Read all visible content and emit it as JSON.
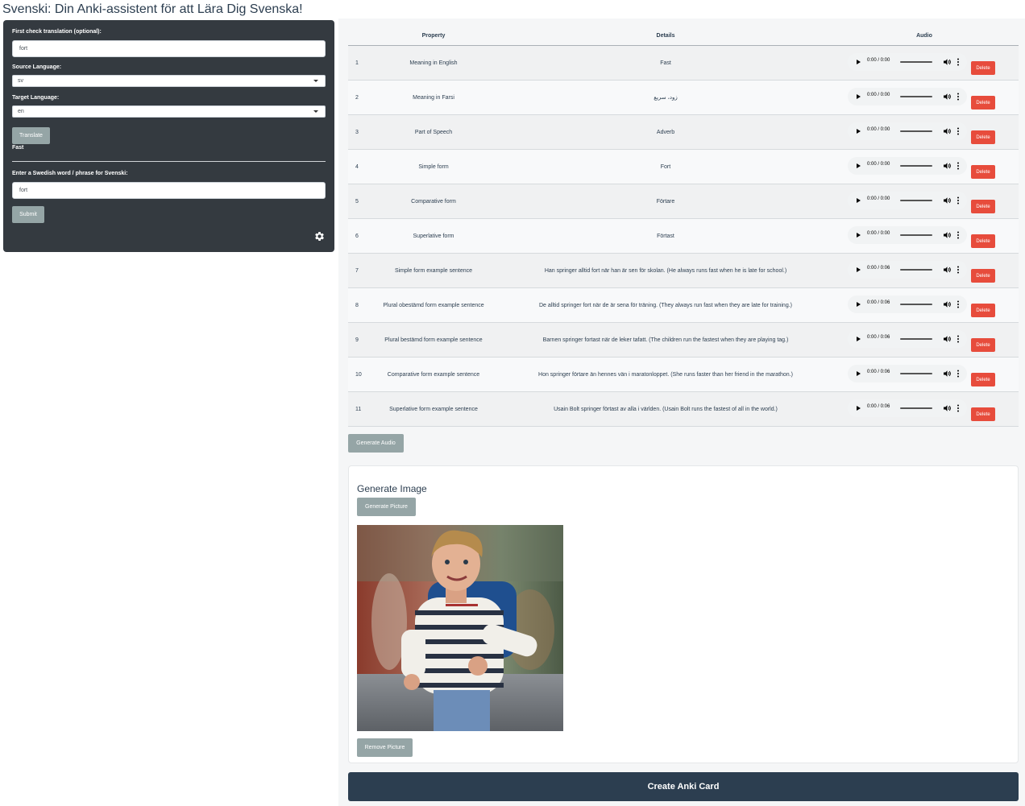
{
  "app_title": "Svenski: Din Anki-assistent för att Lära Dig Svenska!",
  "sidebar": {
    "check_label": "First check translation (optional):",
    "check_value": "fort",
    "source_label": "Source Language:",
    "source_value": "sv",
    "target_label": "Target Language:",
    "target_value": "en",
    "translate_label": "Translate",
    "translation_result": "Fast",
    "word_label": "Enter a Swedish word / phrase for Svenski:",
    "word_value": "fort",
    "submit_label": "Submit",
    "settings_icon": "gear-icon"
  },
  "table": {
    "headers": [
      "Property",
      "Details",
      "Audio"
    ],
    "rows": [
      {
        "num": "1",
        "property": "Meaning in English",
        "details": "Fast",
        "time": "0:00 / 0:00",
        "delete": "Delete"
      },
      {
        "num": "2",
        "property": "Meaning in Farsi",
        "details": "زود، سریع",
        "time": "0:00 / 0:00",
        "delete": "Delete"
      },
      {
        "num": "3",
        "property": "Part of Speech",
        "details": "Adverb",
        "time": "0:00 / 0:00",
        "delete": "Delete"
      },
      {
        "num": "4",
        "property": "Simple form",
        "details": "Fort",
        "time": "0:00 / 0:00",
        "delete": "Delete"
      },
      {
        "num": "5",
        "property": "Comparative form",
        "details": "Förtare",
        "time": "0:00 / 0:00",
        "delete": "Delete"
      },
      {
        "num": "6",
        "property": "Superlative form",
        "details": "Förtast",
        "time": "0:00 / 0:00",
        "delete": "Delete"
      },
      {
        "num": "7",
        "property": "Simple form example sentence",
        "details": "Han springer alltid fort när han är sen för skolan. (He always runs fast when he is late for school.)",
        "time": "0:00 / 0:06",
        "delete": "Delete"
      },
      {
        "num": "8",
        "property": "Plural obestämd form example sentence",
        "details": "De alltid springer fort när de är sena för träning. (They always run fast when they are late for training.)",
        "time": "0:00 / 0:06",
        "delete": "Delete"
      },
      {
        "num": "9",
        "property": "Plural bestämd form example sentence",
        "details": "Barnen springer fortast när de leker tafatt. (The children run the fastest when they are playing tag.)",
        "time": "0:00 / 0:06",
        "delete": "Delete"
      },
      {
        "num": "10",
        "property": "Comparative form example sentence",
        "details": "Hon springer förtare än hennes vän i maratonloppet. (She runs faster than her friend in the marathon.)",
        "time": "0:00 / 0:06",
        "delete": "Delete"
      },
      {
        "num": "11",
        "property": "Superlative form example sentence",
        "details": "Usain Bolt springer förtast av alla i världen. (Usain Bolt runs the fastest of all in the world.)",
        "time": "0:00 / 0:06",
        "delete": "Delete"
      }
    ]
  },
  "generate_audio_label": "Generate Audio",
  "image_card": {
    "title": "Generate Image",
    "generate_label": "Generate Picture",
    "remove_label": "Remove Picture"
  },
  "create_label": "Create Anki Card",
  "colors": {
    "sidebar_bg": "#343a40",
    "primary": "#2c3e50",
    "secondary_button": "#95a5a6",
    "delete_button": "#e74c3c"
  }
}
